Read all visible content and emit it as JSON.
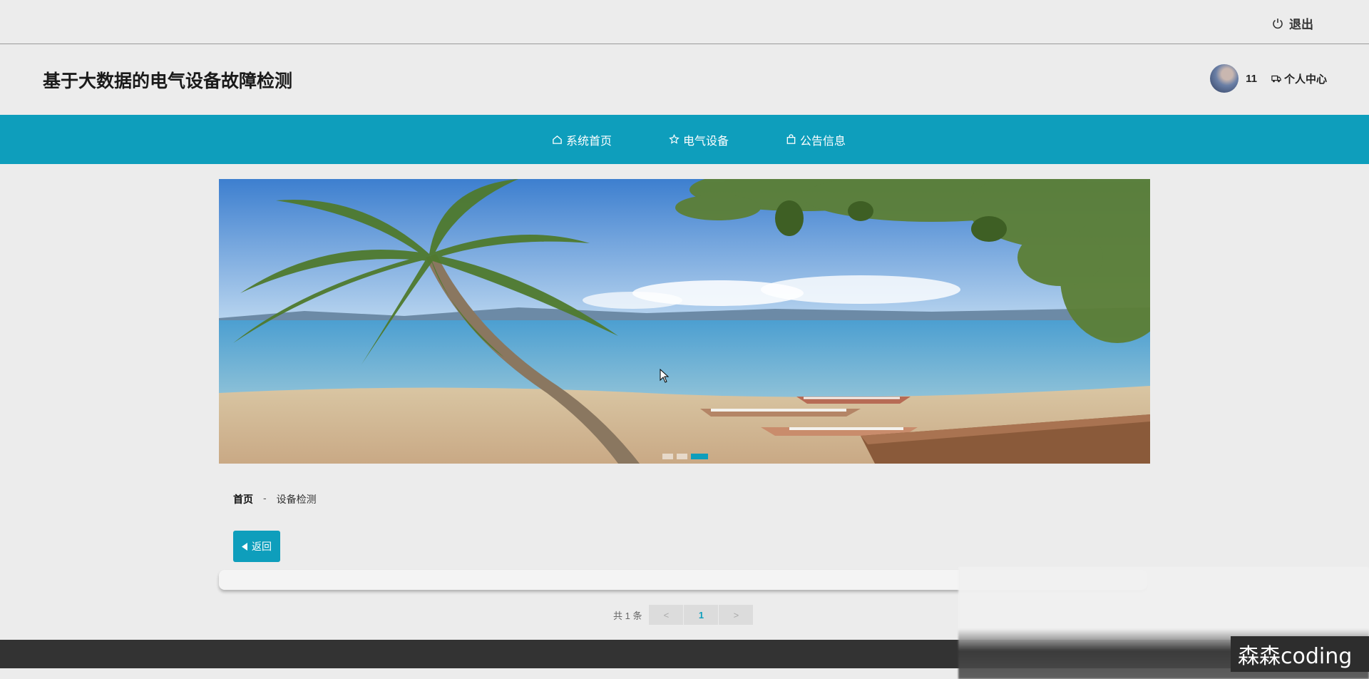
{
  "topbar": {
    "logout_label": "退出",
    "logout_icon": "power-icon"
  },
  "header": {
    "site_title": "基于大数据的电气设备故障检测",
    "username": "11",
    "user_center_label": "个人中心",
    "user_center_icon": "truck-icon"
  },
  "nav": {
    "items": [
      {
        "label": "系统首页",
        "icon": "home-icon"
      },
      {
        "label": "电气设备",
        "icon": "star-icon"
      },
      {
        "label": "公告信息",
        "icon": "bag-icon"
      }
    ]
  },
  "banner": {
    "dot_count": 3,
    "active_index": 2
  },
  "breadcrumb": {
    "home": "首页",
    "separator": "-",
    "current": "设备检测"
  },
  "back_button": {
    "label": "返回"
  },
  "pagination": {
    "total_text": "共 1 条",
    "prev": "<",
    "page": "1",
    "next": ">"
  },
  "watermark": {
    "text": "森森coding"
  },
  "colors": {
    "accent": "#0e9ebc",
    "footer": "#333333",
    "background": "#ececec"
  }
}
